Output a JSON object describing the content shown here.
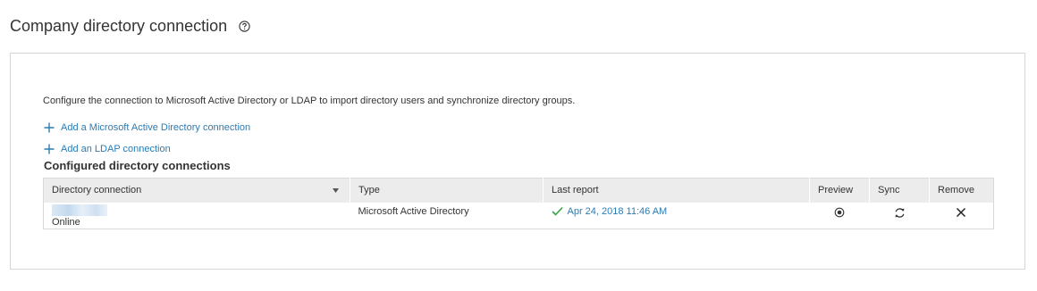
{
  "header": {
    "title": "Company directory connection"
  },
  "panel": {
    "description": "Configure the connection to Microsoft Active Directory or LDAP to import directory users and synchronize directory groups.",
    "add_ad_label": "Add a Microsoft Active Directory connection",
    "add_ldap_label": "Add an LDAP connection",
    "section_title": "Configured directory connections"
  },
  "table": {
    "columns": {
      "connection": "Directory connection",
      "type": "Type",
      "last_report": "Last report",
      "preview": "Preview",
      "sync": "Sync",
      "remove": "Remove"
    },
    "rows": [
      {
        "status": "Online",
        "type": "Microsoft Active Directory",
        "last_report": "Apr 24, 2018 11:46 AM"
      }
    ]
  },
  "icons": {
    "help": "help-circle-icon",
    "add": "plus-icon",
    "sort": "sort-down-icon",
    "report_ok": "checkmark-icon",
    "preview": "preview-icon",
    "sync": "sync-icon",
    "remove": "close-icon"
  },
  "colors": {
    "link": "#2a7cb5",
    "check": "#3aa04a",
    "header_bg": "#ececec"
  }
}
